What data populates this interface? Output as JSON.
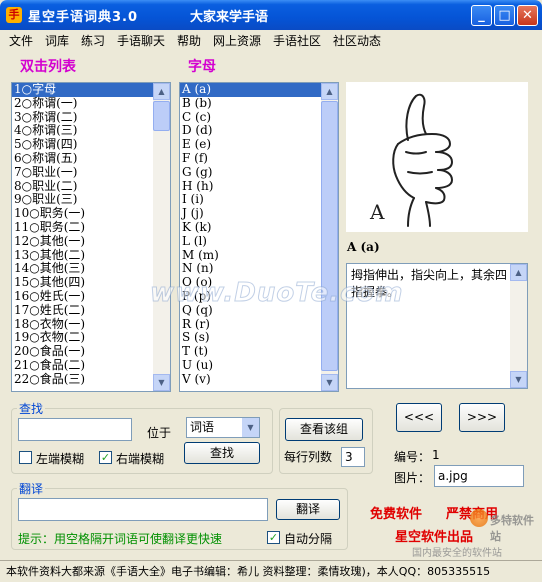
{
  "window": {
    "title": "星空手语词典3.0",
    "subtitle": "大家来学手语",
    "icon": "app-icon"
  },
  "menu": [
    "文件",
    "词库",
    "练习",
    "手语聊天",
    "帮助",
    "网上资源",
    "手语社区",
    "社区动态"
  ],
  "headings": {
    "list": "双击列表",
    "letters": "字母"
  },
  "list": {
    "items": [
      "1○字母",
      "2○称谓(一)",
      "3○称谓(二)",
      "4○称谓(三)",
      "5○称谓(四)",
      "6○称谓(五)",
      "7○职业(一)",
      "8○职业(二)",
      "9○职业(三)",
      "10○职务(一)",
      "11○职务(二)",
      "12○其他(一)",
      "13○其他(二)",
      "14○其他(三)",
      "15○其他(四)",
      "16○姓氏(一)",
      "17○姓氏(二)",
      "18○衣物(一)",
      "19○衣物(二)",
      "20○食品(一)",
      "21○食品(二)",
      "22○食品(三)"
    ],
    "selected_index": 0
  },
  "letters": {
    "items": [
      "A (a)",
      "B (b)",
      "C (c)",
      "D (d)",
      "E (e)",
      "F (f)",
      "G (g)",
      "H (h)",
      "I (i)",
      "J (j)",
      "K (k)",
      "L (l)",
      "M (m)",
      "N (n)",
      "O (o)",
      "P (p)",
      "Q (q)",
      "R (r)",
      "S (s)",
      "T (t)",
      "U (u)",
      "V (v)"
    ],
    "selected_index": 0
  },
  "picture": {
    "letter": "A",
    "icon": "thumbs-up-hand-icon"
  },
  "detail": {
    "word": "A (a)",
    "description": "拇指伸出，指尖向上，其余四指握拳。"
  },
  "watermark": "www.DuoTe.com",
  "search": {
    "group_label": "查找",
    "input_value": "",
    "position_label": "位于",
    "position_select": "词语",
    "left_fuzzy_label": "左端模糊",
    "left_fuzzy_checked": false,
    "right_fuzzy_label": "右端模糊",
    "right_fuzzy_checked": true,
    "find_button": "查找"
  },
  "view_group": {
    "button": "查看该组",
    "columns_label": "每行列数",
    "columns_value": "3"
  },
  "nav": {
    "prev": "<<<",
    "next": ">>>"
  },
  "info": {
    "number_label": "编号：",
    "number_value": "1",
    "image_label": "图片：",
    "image_value": "a.jpg"
  },
  "translate": {
    "group_label": "翻译",
    "input_value": "",
    "button": "翻译",
    "hint": "提示：用空格隔开词语可使翻译更快速",
    "auto_split_label": "自动分隔",
    "auto_split_checked": true
  },
  "promo": {
    "free": "免费软件",
    "no_commercial": "严禁商用",
    "maker": "星空软件出品",
    "overlay_logo": "多特软件站",
    "overlay_tagline": "国内最安全的软件站"
  },
  "colors": {
    "heading": "#d300d0",
    "group_label": "#0046d5",
    "selection": "#316ac5",
    "promo_red": "#e00000",
    "hint_green": "#009000"
  },
  "footer": "本软件资料大都来源《手语大全》电子书编辑：希儿 资料整理：柔情玫瑰)，本人QQ：805335515"
}
